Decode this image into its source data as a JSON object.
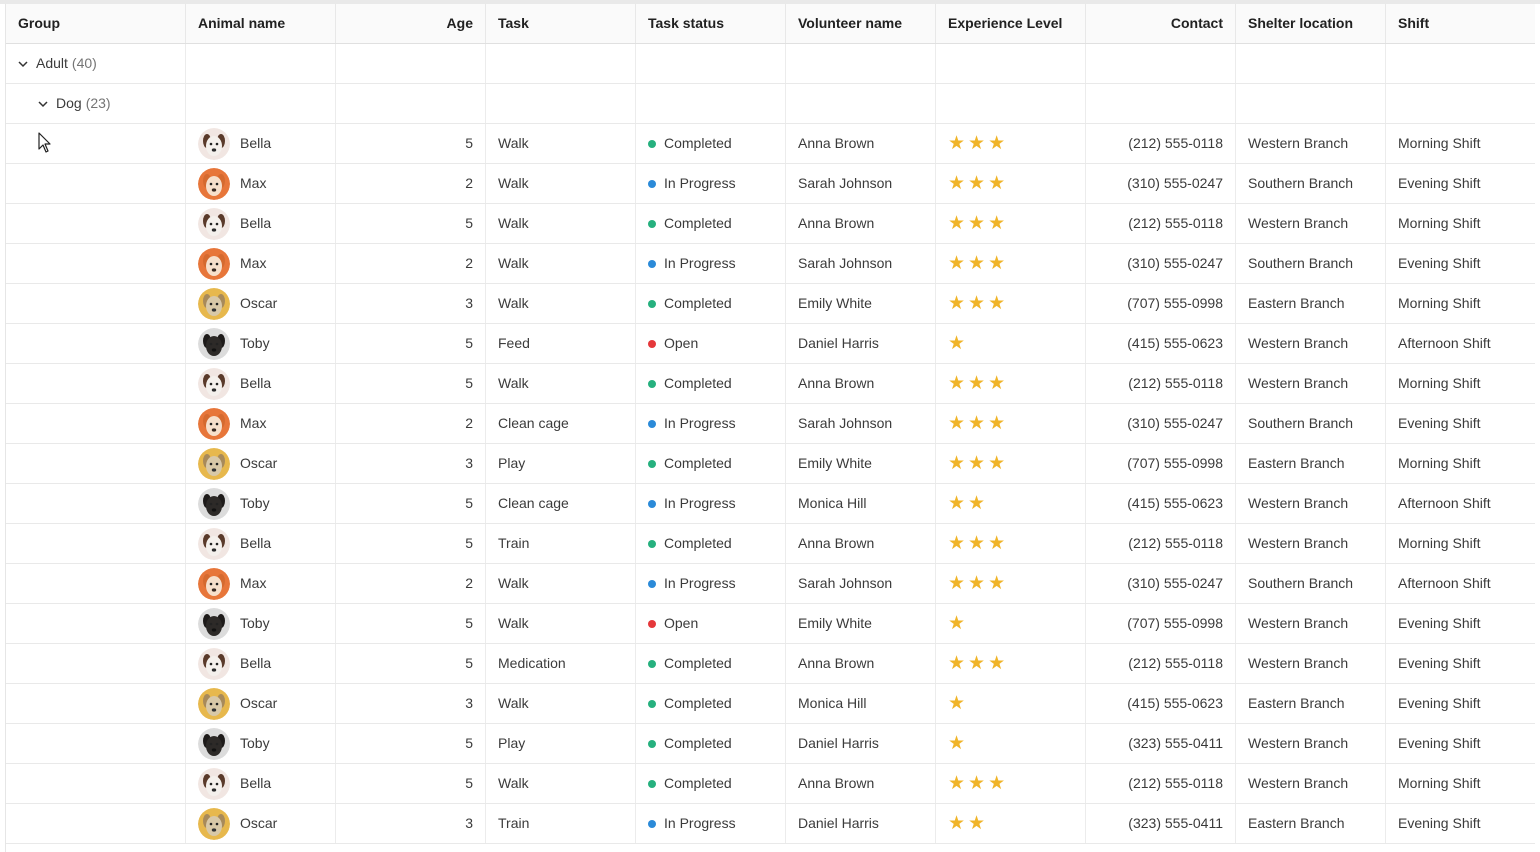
{
  "columns": {
    "group": "Group",
    "animal": "Animal name",
    "age": "Age",
    "task": "Task",
    "status": "Task status",
    "volunteer": "Volunteer name",
    "experience": "Experience Level",
    "contact": "Contact",
    "location": "Shelter location",
    "shift": "Shift"
  },
  "groups": [
    {
      "label": "Adult",
      "count": "(40)"
    },
    {
      "label": "Dog",
      "count": "(23)"
    }
  ],
  "status_colors": {
    "Completed": "#26b07e",
    "In Progress": "#2b8ad8",
    "Open": "#e5383b"
  },
  "star_color": "#f0b429",
  "rows": [
    {
      "animal": "Bella",
      "avatar": "beagle",
      "age": "5",
      "task": "Walk",
      "status": "Completed",
      "volunteer": "Anna Brown",
      "stars": 3,
      "contact": "(212) 555-0118",
      "location": "Western Branch",
      "shift": "Morning Shift"
    },
    {
      "animal": "Max",
      "avatar": "corgi",
      "age": "2",
      "task": "Walk",
      "status": "In Progress",
      "volunteer": "Sarah Johnson",
      "stars": 3,
      "contact": "(310) 555-0247",
      "location": "Southern Branch",
      "shift": "Evening Shift"
    },
    {
      "animal": "Bella",
      "avatar": "beagle",
      "age": "5",
      "task": "Walk",
      "status": "Completed",
      "volunteer": "Anna Brown",
      "stars": 3,
      "contact": "(212) 555-0118",
      "location": "Western Branch",
      "shift": "Morning Shift"
    },
    {
      "animal": "Max",
      "avatar": "corgi",
      "age": "2",
      "task": "Walk",
      "status": "In Progress",
      "volunteer": "Sarah Johnson",
      "stars": 3,
      "contact": "(310) 555-0247",
      "location": "Southern Branch",
      "shift": "Evening Shift"
    },
    {
      "animal": "Oscar",
      "avatar": "terrier",
      "age": "3",
      "task": "Walk",
      "status": "Completed",
      "volunteer": "Emily White",
      "stars": 3,
      "contact": "(707) 555-0998",
      "location": "Eastern Branch",
      "shift": "Morning Shift"
    },
    {
      "animal": "Toby",
      "avatar": "black",
      "age": "5",
      "task": "Feed",
      "status": "Open",
      "volunteer": "Daniel Harris",
      "stars": 1,
      "contact": "(415) 555-0623",
      "location": "Western Branch",
      "shift": "Afternoon Shift"
    },
    {
      "animal": "Bella",
      "avatar": "beagle",
      "age": "5",
      "task": "Walk",
      "status": "Completed",
      "volunteer": "Anna Brown",
      "stars": 3,
      "contact": "(212) 555-0118",
      "location": "Western Branch",
      "shift": "Morning Shift"
    },
    {
      "animal": "Max",
      "avatar": "corgi",
      "age": "2",
      "task": "Clean cage",
      "status": "In Progress",
      "volunteer": "Sarah Johnson",
      "stars": 3,
      "contact": "(310) 555-0247",
      "location": "Southern Branch",
      "shift": "Evening Shift"
    },
    {
      "animal": "Oscar",
      "avatar": "terrier",
      "age": "3",
      "task": "Play",
      "status": "Completed",
      "volunteer": "Emily White",
      "stars": 3,
      "contact": "(707) 555-0998",
      "location": "Eastern Branch",
      "shift": "Morning Shift"
    },
    {
      "animal": "Toby",
      "avatar": "black",
      "age": "5",
      "task": "Clean cage",
      "status": "In Progress",
      "volunteer": "Monica Hill",
      "stars": 2,
      "contact": "(415) 555-0623",
      "location": "Western Branch",
      "shift": "Afternoon Shift"
    },
    {
      "animal": "Bella",
      "avatar": "beagle",
      "age": "5",
      "task": "Train",
      "status": "Completed",
      "volunteer": "Anna Brown",
      "stars": 3,
      "contact": "(212) 555-0118",
      "location": "Western Branch",
      "shift": "Morning Shift"
    },
    {
      "animal": "Max",
      "avatar": "corgi",
      "age": "2",
      "task": "Walk",
      "status": "In Progress",
      "volunteer": "Sarah Johnson",
      "stars": 3,
      "contact": "(310) 555-0247",
      "location": "Southern Branch",
      "shift": "Afternoon Shift"
    },
    {
      "animal": "Toby",
      "avatar": "black",
      "age": "5",
      "task": "Walk",
      "status": "Open",
      "volunteer": "Emily White",
      "stars": 1,
      "contact": "(707) 555-0998",
      "location": "Western Branch",
      "shift": "Evening Shift"
    },
    {
      "animal": "Bella",
      "avatar": "beagle",
      "age": "5",
      "task": "Medication",
      "status": "Completed",
      "volunteer": "Anna Brown",
      "stars": 3,
      "contact": "(212) 555-0118",
      "location": "Western Branch",
      "shift": "Evening Shift"
    },
    {
      "animal": "Oscar",
      "avatar": "terrier",
      "age": "3",
      "task": "Walk",
      "status": "Completed",
      "volunteer": "Monica Hill",
      "stars": 1,
      "contact": "(415) 555-0623",
      "location": "Eastern Branch",
      "shift": "Evening Shift"
    },
    {
      "animal": "Toby",
      "avatar": "black",
      "age": "5",
      "task": "Play",
      "status": "Completed",
      "volunteer": "Daniel Harris",
      "stars": 1,
      "contact": "(323) 555-0411",
      "location": "Western Branch",
      "shift": "Evening Shift"
    },
    {
      "animal": "Bella",
      "avatar": "beagle",
      "age": "5",
      "task": "Walk",
      "status": "Completed",
      "volunteer": "Anna Brown",
      "stars": 3,
      "contact": "(212) 555-0118",
      "location": "Western Branch",
      "shift": "Morning Shift"
    },
    {
      "animal": "Oscar",
      "avatar": "terrier",
      "age": "3",
      "task": "Train",
      "status": "In Progress",
      "volunteer": "Daniel Harris",
      "stars": 2,
      "contact": "(323) 555-0411",
      "location": "Eastern Branch",
      "shift": "Evening Shift"
    }
  ]
}
